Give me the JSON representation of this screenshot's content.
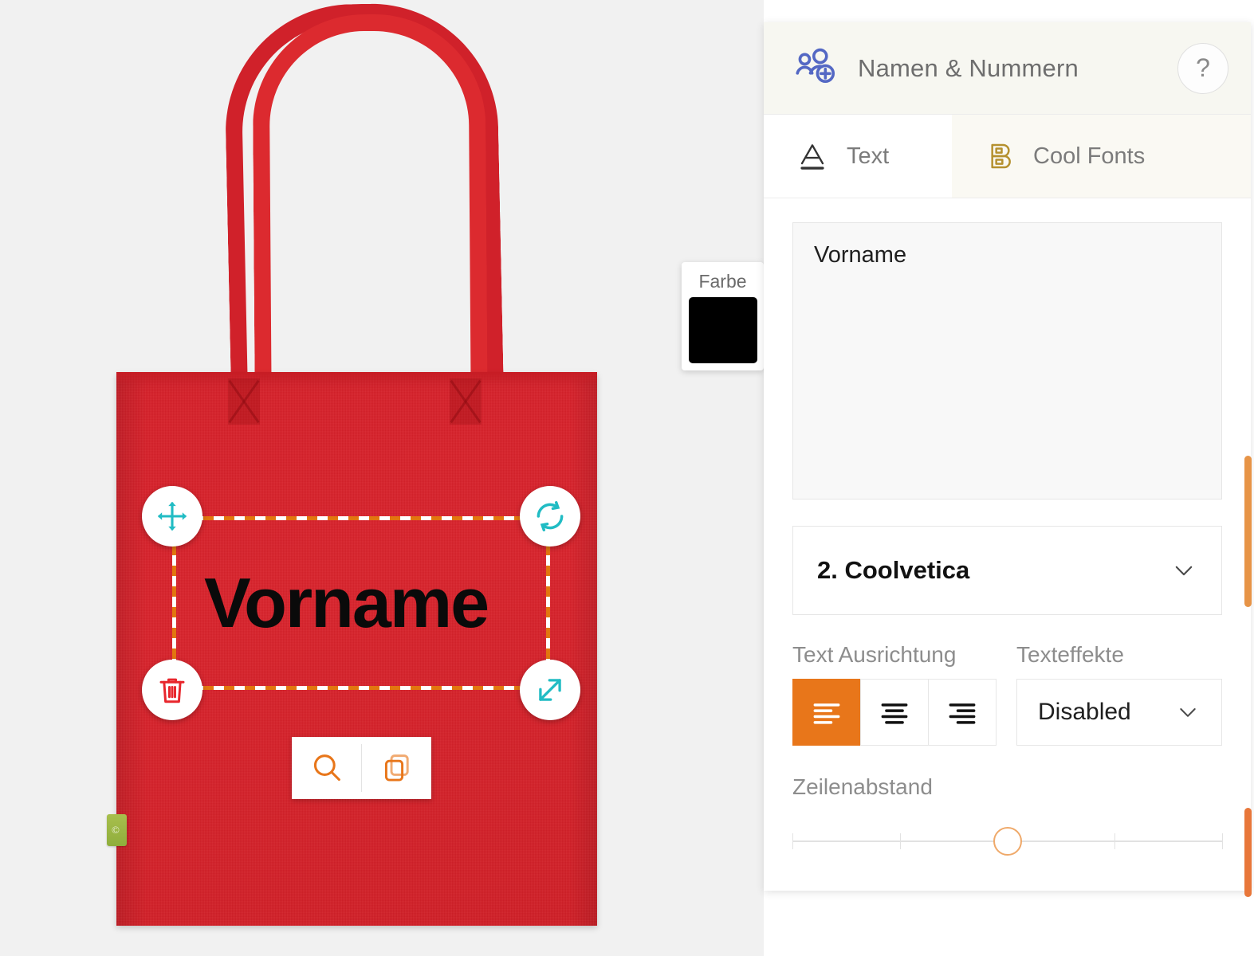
{
  "app": {
    "background_color": "#f1f1f1",
    "accent_color": "#e8761a"
  },
  "canvas": {
    "product": {
      "name": "tote-bag",
      "color": "#d5202a",
      "tag_mark": "©"
    },
    "design": {
      "text": "Vorname",
      "text_color": "#0a0a0a",
      "selection_border_colors": [
        "#ffffff",
        "#e2760f"
      ],
      "handles": [
        {
          "name": "move-handle",
          "icon": "move-arrows-icon",
          "color": "#21bcc4"
        },
        {
          "name": "rotate-handle",
          "icon": "rotate-icon",
          "color": "#21bcc4"
        },
        {
          "name": "delete-handle",
          "icon": "trash-icon",
          "color": "#e8262c"
        },
        {
          "name": "resize-handle",
          "icon": "resize-diagonal-icon",
          "color": "#21bcc4"
        }
      ]
    },
    "design_toolbar": {
      "buttons": [
        {
          "name": "zoom-button",
          "icon": "magnifier-icon",
          "color": "#e8761a"
        },
        {
          "name": "duplicate-button",
          "icon": "copy-icon",
          "color": "#e8761a"
        }
      ]
    },
    "color_card": {
      "label": "Farbe",
      "swatch_color": "#000000"
    }
  },
  "panel": {
    "header": {
      "icon": "users-add-icon",
      "icon_color": "#5468c4",
      "title": "Namen & Nummern",
      "help_label": "?"
    },
    "tabs": [
      {
        "label": "Text",
        "icon": "letter-a-underline-icon",
        "active": true
      },
      {
        "label": "Cool Fonts",
        "icon": "bold-b-icon",
        "active": false
      }
    ],
    "text_input": {
      "value": "Vorname",
      "placeholder": "Vorname"
    },
    "font_select": {
      "value": "2. Coolvetica",
      "chevron": "chevron-down-icon"
    },
    "alignment": {
      "label": "Text Ausrichtung",
      "options": [
        {
          "name": "align-left",
          "active": true
        },
        {
          "name": "align-center",
          "active": false
        },
        {
          "name": "align-right",
          "active": false
        }
      ]
    },
    "effects": {
      "label": "Texteffekte",
      "value": "Disabled",
      "chevron": "chevron-down-icon"
    },
    "line_spacing": {
      "label": "Zeilenabstand",
      "value_percent": 50,
      "tick_positions_percent": [
        0,
        25,
        50,
        75,
        100
      ]
    }
  },
  "scrollbars": {
    "color": "#e79447"
  }
}
